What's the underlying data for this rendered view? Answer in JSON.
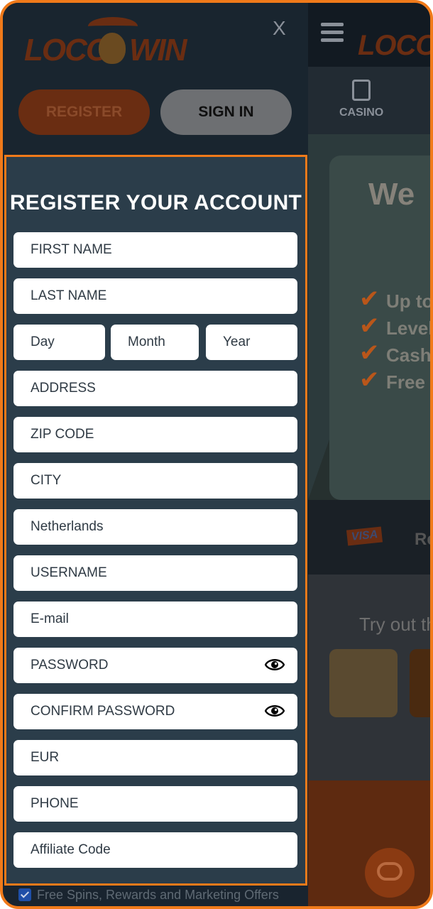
{
  "header": {
    "logo_text_left": "LOCO",
    "logo_text_right": "WIN",
    "close_label": "X",
    "register_label": "REGISTER",
    "signin_label": "SIGN IN"
  },
  "background": {
    "logo": "LOCO",
    "nav_casino": "CASINO",
    "hero_title": "We",
    "bullets": [
      "Up to",
      "Level",
      "Cash",
      "Free s"
    ],
    "payment_visa": "VISA",
    "payment_other": "Re",
    "games_heading": "Try out th"
  },
  "form": {
    "title": "REGISTER YOUR ACCOUNT",
    "first_name": "FIRST NAME",
    "last_name": "LAST NAME",
    "dob_day": "Day",
    "dob_month": "Month",
    "dob_year": "Year",
    "address": "ADDRESS",
    "zip": "ZIP CODE",
    "city": "CITY",
    "country": "Netherlands",
    "username": "USERNAME",
    "email": "E-mail",
    "password": "PASSWORD",
    "confirm_password": "CONFIRM PASSWORD",
    "currency": "EUR",
    "phone": "PHONE",
    "affiliate": "Affiliate Code",
    "consent_label": "Free Spins, Rewards and Marketing Offers"
  },
  "colors": {
    "accent": "#f07a1a",
    "form_bg": "#2b3d4a",
    "panel_bg": "#19242f"
  }
}
